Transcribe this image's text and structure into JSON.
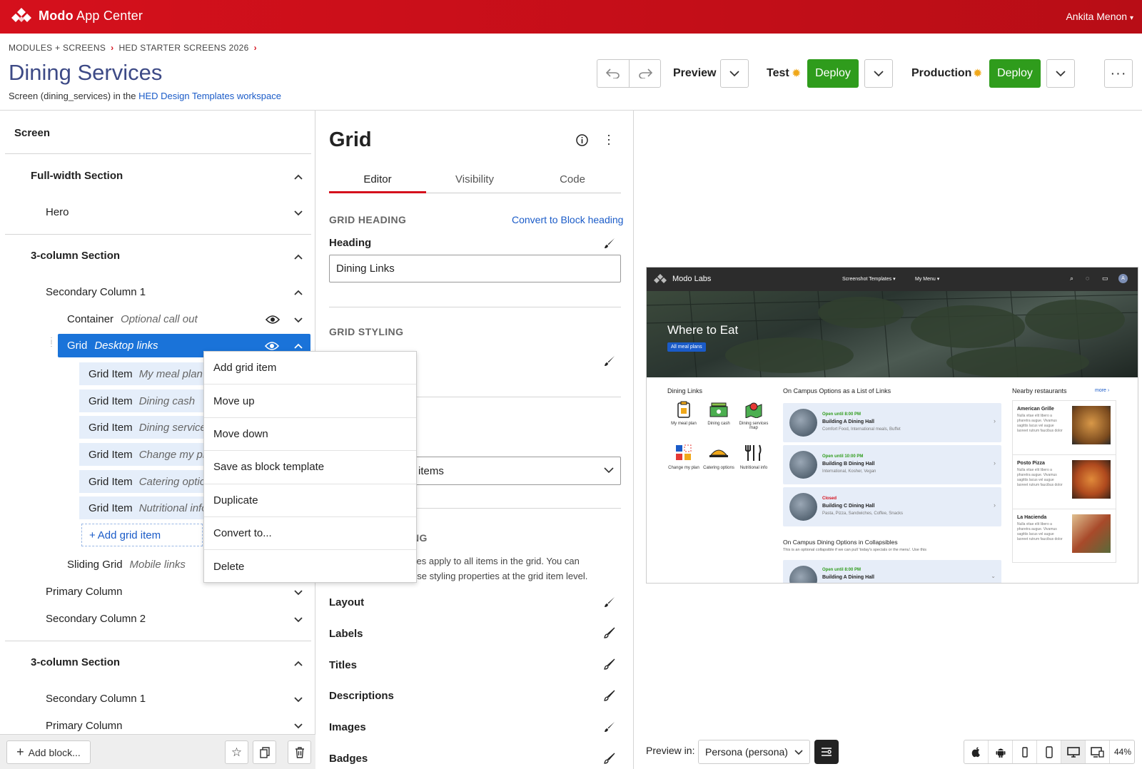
{
  "header": {
    "app_name_bold": "Modo",
    "app_name_rest": " App Center",
    "user": "Ankita Menon",
    "brand_color": "#d5101c"
  },
  "breadcrumb": {
    "items": [
      "MODULES + SCREENS",
      "HED STARTER SCREENS 2026"
    ]
  },
  "page": {
    "title": "Dining Services",
    "subtitle_prefix": "Screen (dining_services) in the ",
    "subtitle_link": "HED Design Templates workspace"
  },
  "toolbar": {
    "preview_label": "Preview",
    "test_label": "Test",
    "production_label": "Production",
    "deploy_label": "Deploy",
    "deploy_color": "#2f9c1c"
  },
  "tree": {
    "header": "Screen",
    "full_width_section": "Full-width Section",
    "hero": "Hero",
    "three_col_1": "3-column Section",
    "secondary_col_1": "Secondary Column 1",
    "container": "Container",
    "container_note": "Optional call out",
    "grid": "Grid",
    "grid_note": "Desktop links",
    "grid_items": [
      {
        "label": "Grid Item",
        "note": "My meal plan"
      },
      {
        "label": "Grid Item",
        "note": "Dining cash"
      },
      {
        "label": "Grid Item",
        "note": "Dining services map"
      },
      {
        "label": "Grid Item",
        "note": "Change my plan"
      },
      {
        "label": "Grid Item",
        "note": "Catering options"
      },
      {
        "label": "Grid Item",
        "note": "Nutritional info"
      }
    ],
    "add_grid_item": "Add grid item",
    "sliding_grid": "Sliding Grid",
    "sliding_grid_note": "Mobile links",
    "primary_column": "Primary Column",
    "secondary_col_2": "Secondary Column 2",
    "three_col_2": "3-column Section",
    "secondary_col_1b": "Secondary Column 1",
    "primary_column_b": "Primary Column",
    "add_block": "Add block..."
  },
  "context_menu": {
    "items": [
      "Add grid item",
      "Move up",
      "Move down",
      "Save as block template",
      "Duplicate",
      "Convert to...",
      "Delete"
    ]
  },
  "editor": {
    "title": "Grid",
    "tabs": [
      "Editor",
      "Visibility",
      "Code"
    ],
    "grid_heading_section": "GRID HEADING",
    "convert_link": "Convert to Block heading",
    "heading_label": "Heading",
    "heading_value": "Dining Links",
    "grid_styling_section": "GRID STYLING",
    "select_value": "items",
    "item_styling_partial": "NG",
    "desc_line1": "ties apply to all items in the grid. You can",
    "desc_line2": "ese styling properties at the grid item level.",
    "props": [
      "Layout",
      "Labels",
      "Titles",
      "Descriptions",
      "Images",
      "Badges"
    ]
  },
  "preview": {
    "brand": "Modo Labs",
    "nav1": "Screenshot Templates",
    "nav2": "My Menu",
    "hero_title": "Where to Eat",
    "hero_button": "All meal plans",
    "dining_links": "Dining Links",
    "grid_labels": [
      "My meal plan",
      "Dining cash",
      "Dining services map",
      "Change my plan",
      "Catering options",
      "Nutritional info"
    ],
    "list_heading": "On Campus Options as a List of Links",
    "cards": [
      {
        "status": "Open until 8:00 PM",
        "name": "Building A Dining Hall",
        "desc": "Comfort Food, International meals, Buffet",
        "status_color": "#2f9c1c"
      },
      {
        "status": "Open until 10:00 PM",
        "name": "Building B Dining Hall",
        "desc": "International, Kosher, Vegan",
        "status_color": "#2f9c1c"
      },
      {
        "status": "Closed",
        "name": "Building C Dining Hall",
        "desc": "Pasta, Pizza, Sandwiches, Coffee, Snacks",
        "status_color": "#d5101c"
      }
    ],
    "collapsible_heading": "On Campus Dining Options in Collapsibles",
    "collapsible_desc": "This is an optional collapsible if we can pull 'today's specials or the menu'. Use this",
    "collapsible_card": {
      "status": "Open until 8:00 PM",
      "name": "Building A Dining Hall"
    },
    "nearby_heading": "Nearby restaurants",
    "more": "more",
    "restaurants": [
      {
        "name": "American Grille",
        "desc": "Nulla vitae elit libero a pharetra augue. Vivamus sagittis lacus vel augue laoreet rutrum faucibus dolor"
      },
      {
        "name": "Posto Pizza",
        "desc": "Nulla vitae elit libero a pharetra augue. Vivamus sagittis lacus vel augue laoreet rutrum faucibus dolor"
      },
      {
        "name": "La Hacienda",
        "desc": "Nulla vitae elit libero a pharetra augue. Vivamus sagittis lacus vel augue laoreet rutrum faucibus dolor"
      }
    ]
  },
  "footer": {
    "preview_in": "Preview in:",
    "persona": "Persona (persona)",
    "zoom": "44%"
  }
}
